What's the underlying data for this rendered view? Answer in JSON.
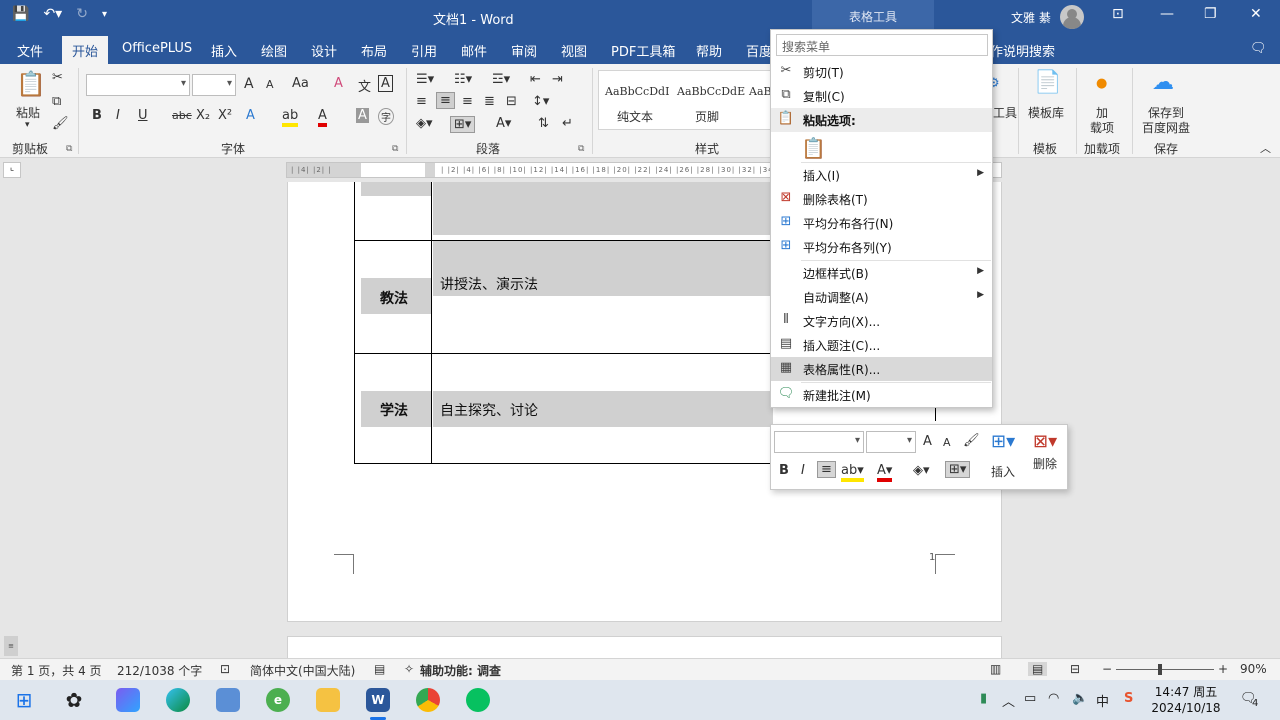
{
  "window": {
    "doc_title": "文档1 - Word",
    "tools_band": "表格工具",
    "user_name": "文雅 綦",
    "tell_me": "作说明搜索"
  },
  "tabs": [
    "文件",
    "开始",
    "OfficePLUS",
    "插入",
    "绘图",
    "设计",
    "布局",
    "引用",
    "邮件",
    "审阅",
    "视图",
    "PDF工具箱",
    "帮助",
    "百度"
  ],
  "ribbon": {
    "paste_label": "粘贴",
    "groups": {
      "clipboard": "剪贴板",
      "font": "字体",
      "paragraph": "段落",
      "styles": "样式",
      "templates": "模板",
      "addins": "加载项",
      "save": "保存"
    },
    "font_buttons": {
      "bold": "B",
      "italic": "I",
      "underline": "U",
      "strike": "abc",
      "subscript": "X₂",
      "superscript": "X²",
      "grow": "A",
      "shrink": "A",
      "case": "Aa",
      "clear": "A",
      "box": "A",
      "phonetic": "文",
      "highlight": "ab",
      "color": "A",
      "shade": "A",
      "enclose": "字"
    },
    "styles": [
      {
        "sample": "AaBbCcDdI",
        "name": "纯文本"
      },
      {
        "sample": "AaBbCcDdE",
        "name": "页脚"
      },
      {
        "sample": "AaBb",
        "name": ""
      }
    ],
    "tools_partial": "工具",
    "template_lib": "模板库",
    "addin_line1": "加",
    "addin_line2": "载项",
    "save_baidu_1": "保存到",
    "save_baidu_2": "百度网盘"
  },
  "ruler": {
    "left_ticks": "| |4| |2| |",
    "main_ticks": "| |2| |4| |6| |8| |10| |12| |14| |16| |18| |20| |22| |24| |26| |28| |30| |32| |34| |36| |38|"
  },
  "table": {
    "rows": [
      {
        "label": "",
        "content": ""
      },
      {
        "label": "教法",
        "content": "讲授法、演示法"
      },
      {
        "label": "学法",
        "content": "自主探究、讨论"
      }
    ],
    "page_number": "1"
  },
  "context_menu": {
    "search_placeholder": "搜索菜单",
    "items": [
      {
        "label": "剪切(T)",
        "icon": "cut-icon"
      },
      {
        "label": "复制(C)",
        "icon": "copy-icon"
      },
      {
        "label": "粘贴选项:",
        "icon": "paste-icon"
      },
      {
        "label": "插入(I)",
        "icon": "",
        "submenu": true
      },
      {
        "label": "删除表格(T)",
        "icon": "delete-table-icon"
      },
      {
        "label": "平均分布各行(N)",
        "icon": "distribute-rows-icon"
      },
      {
        "label": "平均分布各列(Y)",
        "icon": "distribute-columns-icon"
      },
      {
        "label": "边框样式(B)",
        "icon": "",
        "submenu": true
      },
      {
        "label": "自动调整(A)",
        "icon": "",
        "submenu": true
      },
      {
        "label": "文字方向(X)...",
        "icon": "text-direction-icon"
      },
      {
        "label": "插入题注(C)...",
        "icon": "caption-icon"
      },
      {
        "label": "表格属性(R)...",
        "icon": "table-properties-icon"
      },
      {
        "label": "新建批注(M)",
        "icon": "new-comment-icon"
      }
    ]
  },
  "mini_toolbar": {
    "insert_label": "插入",
    "delete_label": "删除",
    "bold": "B",
    "italic": "I"
  },
  "status": {
    "page": "第 1 页，共 4 页",
    "words": "212/1038 个字",
    "language": "简体中文(中国大陆)",
    "accessibility": "辅助功能: 调查",
    "zoom": "90%"
  },
  "taskbar": {
    "ime": "中",
    "time": "14:47 周五",
    "date": "2024/10/18",
    "notifications": "4"
  },
  "colors": {
    "brand": "#2b579a",
    "highlight_yellow": "#ffe600",
    "font_red": "#e00000"
  }
}
